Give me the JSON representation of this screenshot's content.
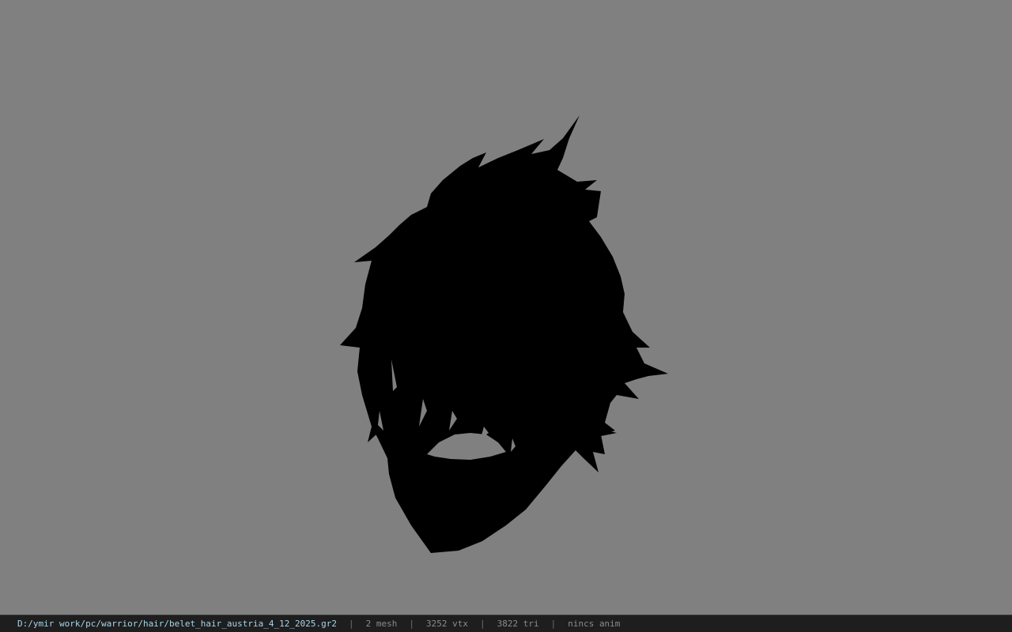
{
  "viewport": {
    "model_name": "hair-mesh-silhouette",
    "background_color": "#808080",
    "mesh_color": "#000000"
  },
  "status_bar": {
    "file_path": "D:/ymir work/pc/warrior/hair/belet_hair_austria_4_12_2025.gr2",
    "separator": "|",
    "mesh_count": "2 mesh",
    "vertex_count": "3252 vtx",
    "triangle_count": "3822 tri",
    "animation_status": "nincs anim"
  }
}
